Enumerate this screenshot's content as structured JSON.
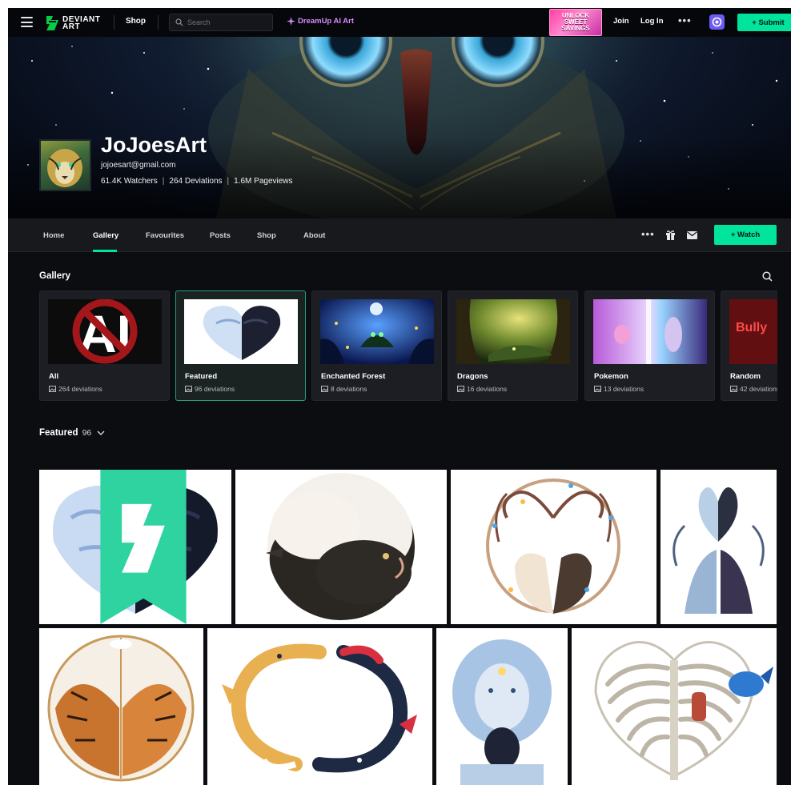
{
  "topbar": {
    "logo_text_line1": "DEVIANT",
    "logo_text_line2": "ART",
    "shop_label": "Shop",
    "search_placeholder": "Search",
    "dreamup_label": "DreamUp AI Art",
    "ad_line1": "UNLOCK",
    "ad_line2": "SWEET",
    "ad_line3": "SAVINGS",
    "join_label": "Join",
    "login_label": "Log In",
    "more_label": "•••",
    "submit_label": "+ Submit"
  },
  "profile": {
    "name": "JoJoesArt",
    "email": "jojoesart@gmail.com",
    "watchers": "61.4K Watchers",
    "deviations": "264 Deviations",
    "pageviews": "1.6M Pageviews",
    "separator": "|"
  },
  "nav": {
    "tabs": [
      {
        "label": "Home"
      },
      {
        "label": "Gallery"
      },
      {
        "label": "Favourites"
      },
      {
        "label": "Posts"
      },
      {
        "label": "Shop"
      },
      {
        "label": "About"
      }
    ],
    "more_label": "•••",
    "watch_label": "+ Watch"
  },
  "gallery": {
    "title": "Gallery",
    "folders": [
      {
        "name": "All",
        "count": "264 deviations"
      },
      {
        "name": "Featured",
        "count": "96 deviations"
      },
      {
        "name": "Enchanted Forest",
        "count": "8 deviations"
      },
      {
        "name": "Dragons",
        "count": "16 deviations"
      },
      {
        "name": "Pokemon",
        "count": "13 deviations"
      },
      {
        "name": "Random",
        "count": "42 deviations"
      }
    ],
    "random_thumb_text": "Bully",
    "all_thumb_text": "AI"
  },
  "featured": {
    "label": "Featured",
    "count": "96"
  },
  "colors": {
    "accent": "#00e59b",
    "background": "#0c0d10",
    "dreamup": "#d88cff"
  }
}
